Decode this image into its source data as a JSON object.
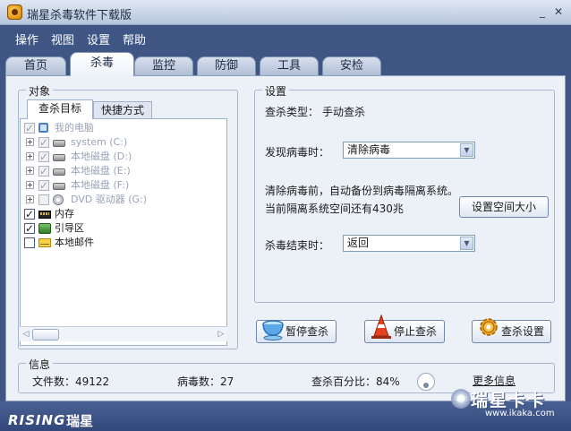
{
  "window": {
    "title": "瑞星杀毒软件下载版"
  },
  "menu": [
    "操作",
    "视图",
    "设置",
    "帮助"
  ],
  "tabs": [
    {
      "label": "首页",
      "active": false
    },
    {
      "label": "杀毒",
      "active": true
    },
    {
      "label": "监控",
      "active": false
    },
    {
      "label": "防御",
      "active": false
    },
    {
      "label": "工具",
      "active": false
    },
    {
      "label": "安检",
      "active": false
    }
  ],
  "objects": {
    "group_label": "对象",
    "subtabs": [
      "查杀目标",
      "快捷方式"
    ],
    "tree": [
      {
        "label": "我的电脑",
        "checked": true,
        "disabled": true,
        "icon": "computer-icon"
      },
      {
        "label": "system (C:)",
        "checked": true,
        "disabled": true,
        "icon": "drive-icon"
      },
      {
        "label": "本地磁盘 (D:)",
        "checked": true,
        "disabled": true,
        "icon": "drive-icon"
      },
      {
        "label": "本地磁盘 (E:)",
        "checked": true,
        "disabled": true,
        "icon": "drive-icon"
      },
      {
        "label": "本地磁盘 (F:)",
        "checked": true,
        "disabled": true,
        "icon": "drive-icon"
      },
      {
        "label": "DVD 驱动器 (G:)",
        "checked": false,
        "disabled": true,
        "icon": "dvd-icon"
      },
      {
        "label": "内存",
        "checked": true,
        "disabled": false,
        "icon": "memory-icon"
      },
      {
        "label": "引导区",
        "checked": true,
        "disabled": false,
        "icon": "boot-sector-icon"
      },
      {
        "label": "本地邮件",
        "checked": false,
        "disabled": false,
        "icon": "mail-icon"
      }
    ]
  },
  "settings": {
    "group_label": "设置",
    "scan_type_label": "查杀类型：",
    "scan_type_value": "手动查杀",
    "on_virus_label": "发现病毒时：",
    "on_virus_value": "清除病毒",
    "backup_note": "清除病毒前，自动备份到病毒隔离系统。",
    "quarantine_note": "当前隔离系统空间还有430兆",
    "set_space_button": "设置空间大小",
    "on_finish_label": "杀毒结束时：",
    "on_finish_value": "返回"
  },
  "actions": {
    "pause": "暂停查杀",
    "stop": "停止查杀",
    "config": "查杀设置"
  },
  "info": {
    "group_label": "信息",
    "files": "文件数：49122",
    "viruses": "病毒数：27",
    "progress": "查杀百分比：84%",
    "progress_percent": 84,
    "more": "更多信息"
  },
  "footer": {
    "logo_text": "RISING",
    "logo_cn": "瑞星",
    "watermark_title": "瑞星卡卡",
    "watermark_url": "www.ikaka.com"
  },
  "colors": {
    "frame": "#3f5684",
    "panel": "#ecf0f7",
    "accent": "#7f93b3"
  }
}
